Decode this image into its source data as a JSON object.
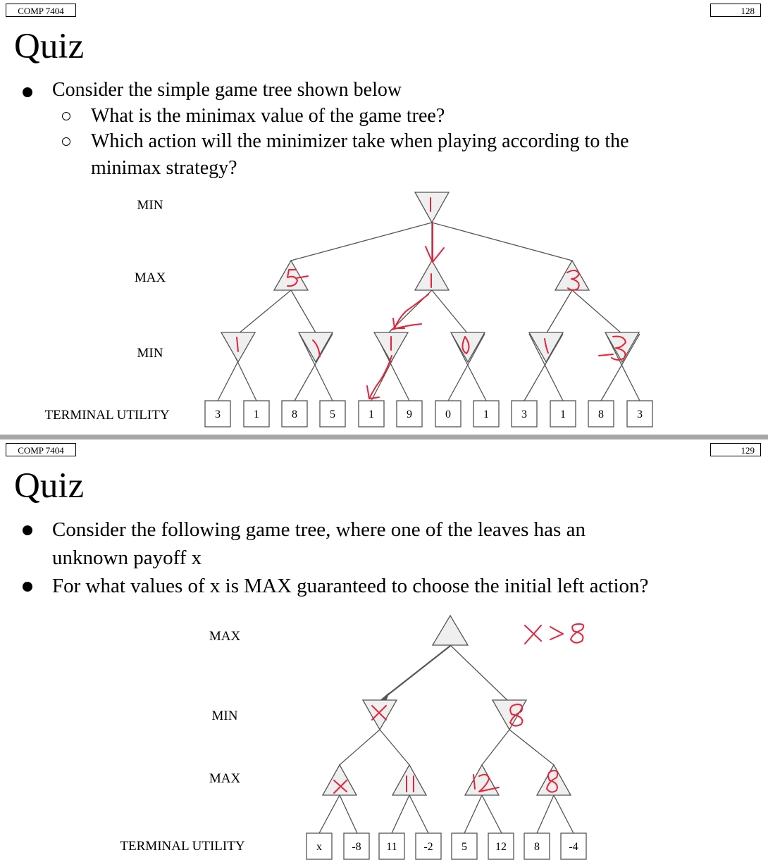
{
  "slides": [
    {
      "course": "COMP 7404",
      "page": "128",
      "title": "Quiz",
      "bullets": [
        {
          "level": 1,
          "text": "Consider the simple game tree shown below"
        },
        {
          "level": 2,
          "text": "What is the minimax value of the game tree?"
        },
        {
          "level": 2,
          "text": "Which action will the minimizer take when playing according to the"
        },
        {
          "level": 2,
          "text": "minimax strategy?",
          "continuation": true
        }
      ],
      "tree": {
        "level_labels": [
          "MIN",
          "MAX",
          "MIN",
          "TERMINAL UTILITY"
        ],
        "leaves": [
          "3",
          "1",
          "8",
          "5",
          "1",
          "9",
          "0",
          "1",
          "3",
          "1",
          "8",
          "3"
        ],
        "annotations": {
          "root": "1",
          "max_nodes": [
            "5",
            "1",
            "3"
          ],
          "min_nodes": [
            "1",
            "5",
            "1",
            "0",
            "1",
            "3"
          ]
        }
      }
    },
    {
      "course": "COMP 7404",
      "page": "129",
      "title": "Quiz",
      "bullets": [
        {
          "level": 1,
          "text": "Consider the following game tree, where one of the leaves has an"
        },
        {
          "level": 1,
          "text": "unknown payoff x",
          "continuation": true
        },
        {
          "level": 1,
          "text": "For what values of x is MAX guaranteed to choose the initial left action?"
        }
      ],
      "tree": {
        "level_labels": [
          "MAX",
          "MIN",
          "MAX",
          "TERMINAL UTILITY"
        ],
        "leaves": [
          "x",
          "-8",
          "11",
          "-2",
          "5",
          "12",
          "8",
          "-4"
        ],
        "annotations": {
          "answer": "x>8",
          "min_nodes": [
            "x",
            "8"
          ],
          "max_nodes": [
            "x",
            "11",
            "12",
            "8"
          ]
        }
      }
    }
  ],
  "colors": {
    "node_fill": "#efefef",
    "node_stroke": "#555555",
    "ink": "#e8213a",
    "divider": "#a6a6a6"
  }
}
